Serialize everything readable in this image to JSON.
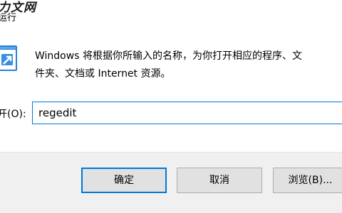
{
  "watermark": {
    "text": "力文网"
  },
  "title": "运行",
  "description": {
    "line1": "Windows 将根据你所输入的名称，为你打开相应的程序、文",
    "line2": "件夹、文档或 Internet 资源。"
  },
  "open_field": {
    "label": "开(O):",
    "value": "regedit"
  },
  "buttons": {
    "ok": "确定",
    "cancel": "取消",
    "browse": "浏览(B)..."
  },
  "icons": {
    "run": "run-dialog-icon"
  },
  "colors": {
    "accent": "#0078d7",
    "footer_bg": "#f0f0f0",
    "button_bg": "#e1e1e1"
  }
}
